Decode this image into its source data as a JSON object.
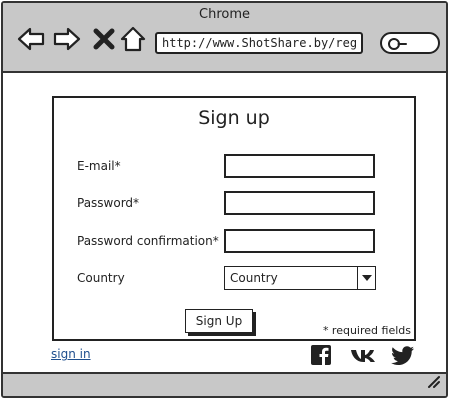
{
  "window": {
    "title": "Chrome"
  },
  "toolbar": {
    "back_icon": "back-arrow-icon",
    "forward_icon": "forward-arrow-icon",
    "stop_icon": "close-icon",
    "home_icon": "home-icon",
    "url": "http://www.ShotShare.by/reg",
    "search_icon": "search-icon"
  },
  "form": {
    "title": "Sign up",
    "email_label": "E-mail*",
    "email_value": "",
    "password_label": "Password*",
    "password_value": "",
    "password_confirm_label": "Password confirmation*",
    "password_confirm_value": "",
    "country_label": "Country",
    "country_selected": "Country",
    "submit_label": "Sign Up",
    "required_note": "* required fields"
  },
  "footer": {
    "signin_label": "sign in",
    "social_icons": [
      "facebook-icon",
      "vk-icon",
      "twitter-icon"
    ]
  }
}
